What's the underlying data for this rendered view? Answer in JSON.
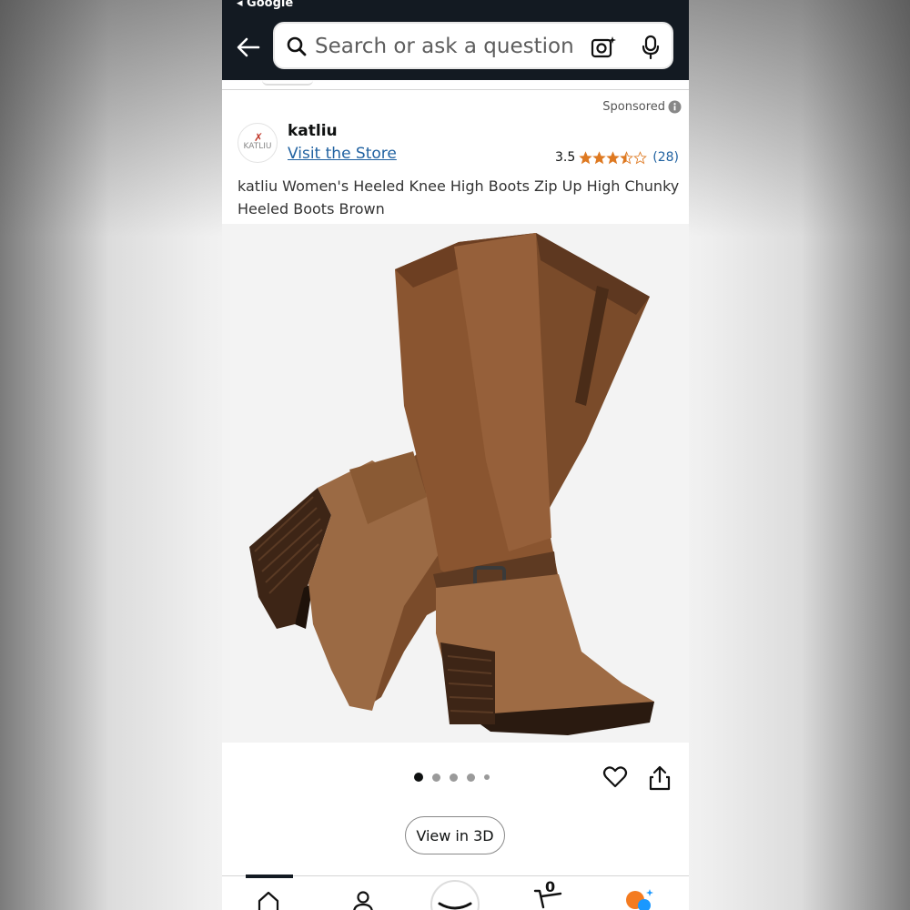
{
  "browser": {
    "back_label": "◂ Google"
  },
  "search": {
    "placeholder": "Search or ask a question"
  },
  "ad": {
    "sponsored_label": "Sponsored"
  },
  "store": {
    "logo_text": "KATLIU",
    "name": "katliu",
    "visit_label": "Visit the Store"
  },
  "rating": {
    "value": "3.5",
    "stars": 3.5,
    "max_stars": 5,
    "count": "(28)",
    "star_color": "#de7921"
  },
  "product": {
    "title": "katliu Women's Heeled Knee High Boots Zip Up High Chunky Heeled Boots Brown",
    "color": "Brown"
  },
  "gallery": {
    "image_count": 5,
    "active_index": 0
  },
  "actions": {
    "view_3d_label": "View in 3D"
  },
  "bottom_nav": {
    "items": [
      "home-icon",
      "account-icon",
      "amazon-smile-icon",
      "cart-icon",
      "rufus-ai-icon"
    ],
    "cart_count": "0"
  },
  "colors": {
    "header_bg": "#131a22",
    "link": "#2162a1",
    "boot_brown": "#8a5a34"
  }
}
